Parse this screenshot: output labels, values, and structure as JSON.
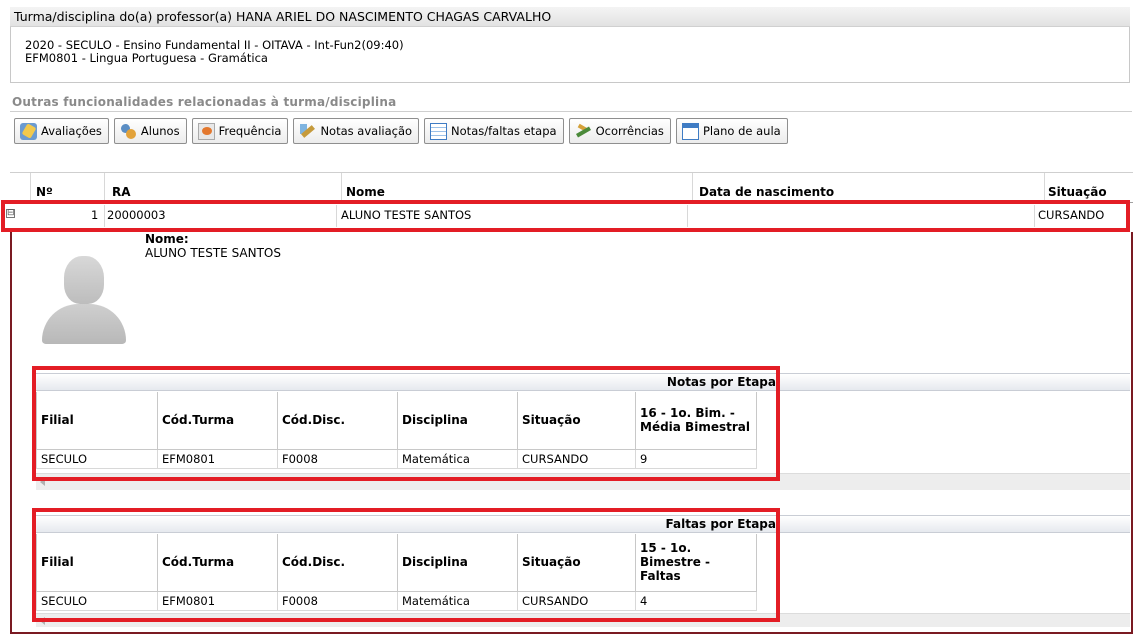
{
  "title": "Turma/disciplina do(a) professor(a) HANA ARIEL DO NASCIMENTO CHAGAS CARVALHO",
  "info": {
    "line1": "2020 - SECULO - Ensino Fundamental II - OITAVA - Int-Fun2(09:40)",
    "line2": "EFM0801 - Lingua Portuguesa - Gramática"
  },
  "section_label": "Outras funcionalidades relacionadas à turma/disciplina",
  "toolbar": [
    {
      "label": "Avaliações",
      "icon": "avaliacoes-icon"
    },
    {
      "label": "Alunos",
      "icon": "alunos-icon"
    },
    {
      "label": "Frequência",
      "icon": "frequencia-icon"
    },
    {
      "label": "Notas avaliação",
      "icon": "notas-avaliacao-icon"
    },
    {
      "label": "Notas/faltas etapa",
      "icon": "table-icon"
    },
    {
      "label": "Ocorrências",
      "icon": "ocorrencias-icon"
    },
    {
      "label": "Plano de aula",
      "icon": "calendar-icon"
    }
  ],
  "grid": {
    "columns": [
      "Nº",
      "RA",
      "Nome",
      "Data de nascimento",
      "Situação"
    ],
    "rows": [
      {
        "expander": "⊟",
        "num": "1",
        "ra": "20000003",
        "nome": "ALUNO TESTE SANTOS",
        "nascimento": "",
        "situacao": "CURSANDO"
      }
    ]
  },
  "detail": {
    "nome_label": "Nome:",
    "nome_value": "ALUNO TESTE SANTOS"
  },
  "notas": {
    "title": "Notas por Etapa",
    "columns": [
      "Filial",
      "Cód.Turma",
      "Cód.Disc.",
      "Disciplina",
      "Situação",
      "16 - 1o. Bim. - Média Bimestral"
    ],
    "rows": [
      [
        "SECULO",
        "EFM0801",
        "F0008",
        "Matemática",
        "CURSANDO",
        "9"
      ]
    ]
  },
  "faltas": {
    "title": "Faltas por Etapa",
    "columns": [
      "Filial",
      "Cód.Turma",
      "Cód.Disc.",
      "Disciplina",
      "Situação",
      "15 - 1o. Bimestre - Faltas"
    ],
    "rows": [
      [
        "SECULO",
        "EFM0801",
        "F0008",
        "Matemática",
        "CURSANDO",
        "4"
      ]
    ]
  },
  "colors": {
    "highlight": "#e31d25",
    "detail_border": "#7a1a22"
  }
}
